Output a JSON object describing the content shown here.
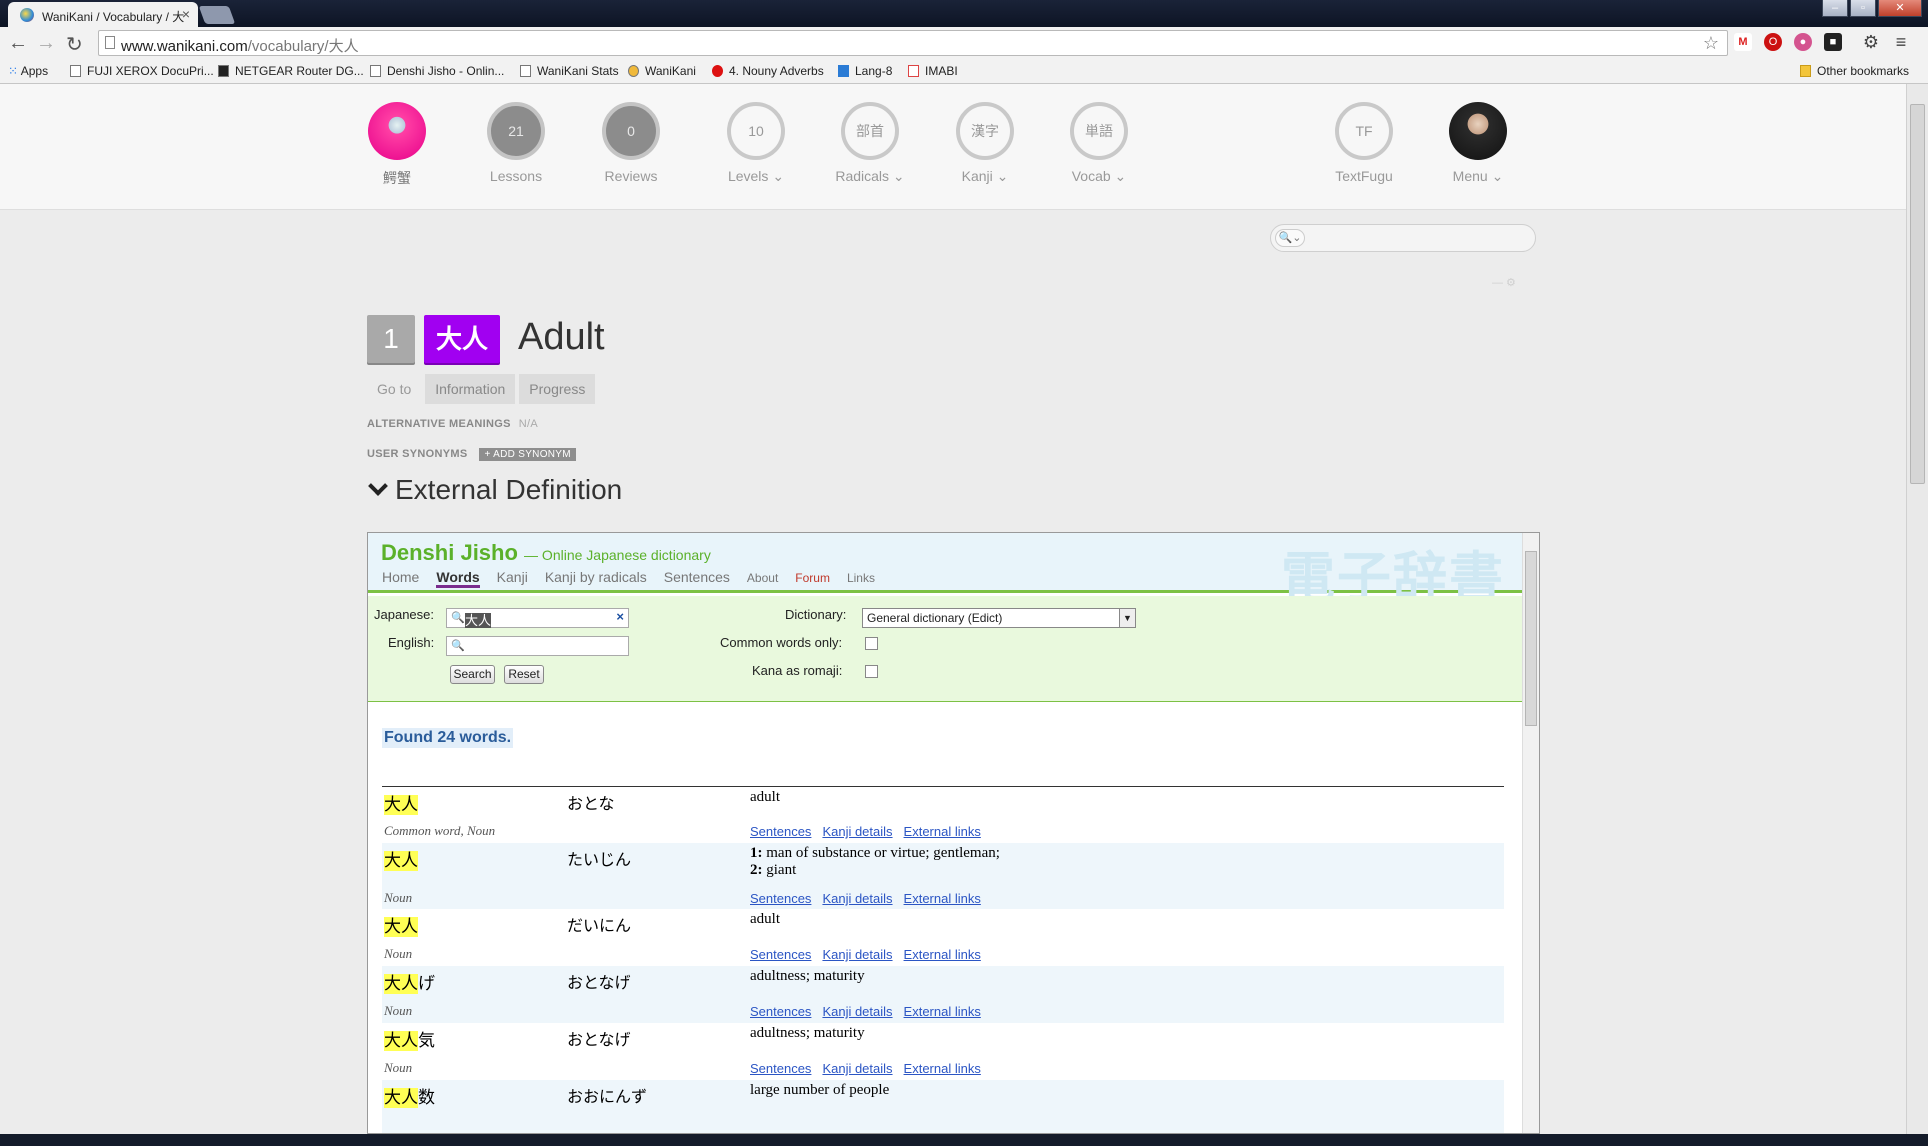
{
  "browser": {
    "tab_title": "WaniKani / Vocabulary / 大",
    "tab_close": "×",
    "url_host": "www.wanikani.com",
    "url_path": "/vocabulary/大人",
    "bookmarks": [
      "Apps",
      "FUJI XEROX DocuPri...",
      "NETGEAR Router DG...",
      "Denshi Jisho - Onlin...",
      "WaniKani Stats",
      "WaniKani",
      "4. Nouny Adverbs",
      "Lang-8",
      "IMABI"
    ],
    "other_bookmarks": "Other bookmarks"
  },
  "nav": {
    "user_label": "鰐蟹",
    "lessons": {
      "count": "21",
      "label": "Lessons"
    },
    "reviews": {
      "count": "0",
      "label": "Reviews"
    },
    "levels": {
      "icon": "10",
      "label": "Levels"
    },
    "radicals": {
      "icon": "部首",
      "label": "Radicals"
    },
    "kanji": {
      "icon": "漢字",
      "label": "Kanji"
    },
    "vocab": {
      "icon": "単語",
      "label": "Vocab"
    },
    "textfugu": {
      "icon": "TF",
      "label": "TextFugu"
    },
    "menu": {
      "label": "Menu"
    },
    "caret": "⌄"
  },
  "search": {
    "icon": "🔍⌄"
  },
  "vocab": {
    "level": "1",
    "characters": "大人",
    "meaning": "Adult",
    "subnav": [
      "Go to",
      "Information",
      "Progress"
    ],
    "alt_meanings_label": "ALTERNATIVE MEANINGS",
    "alt_meanings_value": "N/A",
    "user_synonyms_label": "USER SYNONYMS",
    "add_synonym": "+ ADD SYNONYM",
    "section_title": "External Definition"
  },
  "jisho": {
    "logo": "Denshi Jisho",
    "tagline": "— Online Japanese dictionary",
    "bg_text": "電子辞書",
    "nav": [
      "Home",
      "Words",
      "Kanji",
      "Kanji by radicals",
      "Sentences",
      "About",
      "Forum",
      "Links"
    ],
    "form": {
      "japanese_label": "Japanese:",
      "japanese_value": "大人",
      "english_label": "English:",
      "search_btn": "Search",
      "reset_btn": "Reset",
      "dictionary_label": "Dictionary:",
      "dictionary_value": "General dictionary (Edict)",
      "common_label": "Common words only:",
      "romaji_label": "Kana as romaji:"
    },
    "found": "Found 24 words.",
    "links": [
      "Sentences",
      "Kanji details",
      "External links"
    ],
    "results": [
      {
        "hl": "大人",
        "rest": "",
        "reading": "おとな",
        "meaning1": "adult",
        "meaning2": "",
        "tags": "Common word, Noun"
      },
      {
        "hl": "大人",
        "rest": "",
        "reading": "たいじん",
        "meaning1": "man of substance or virtue; gentleman;",
        "meaning2": "giant",
        "tags": "Noun"
      },
      {
        "hl": "大人",
        "rest": "",
        "reading": "だいにん",
        "meaning1": "adult",
        "meaning2": "",
        "tags": "Noun"
      },
      {
        "hl": "大人",
        "rest": "げ",
        "reading": "おとなげ",
        "meaning1": "adultness; maturity",
        "meaning2": "",
        "tags": "Noun"
      },
      {
        "hl": "大人",
        "rest": "気",
        "reading": "おとなげ",
        "meaning1": "adultness; maturity",
        "meaning2": "",
        "tags": "Noun"
      },
      {
        "hl": "大人",
        "rest": "数",
        "reading": "おおにんず",
        "meaning1": "large number of people",
        "meaning2": "",
        "tags": ""
      }
    ]
  }
}
